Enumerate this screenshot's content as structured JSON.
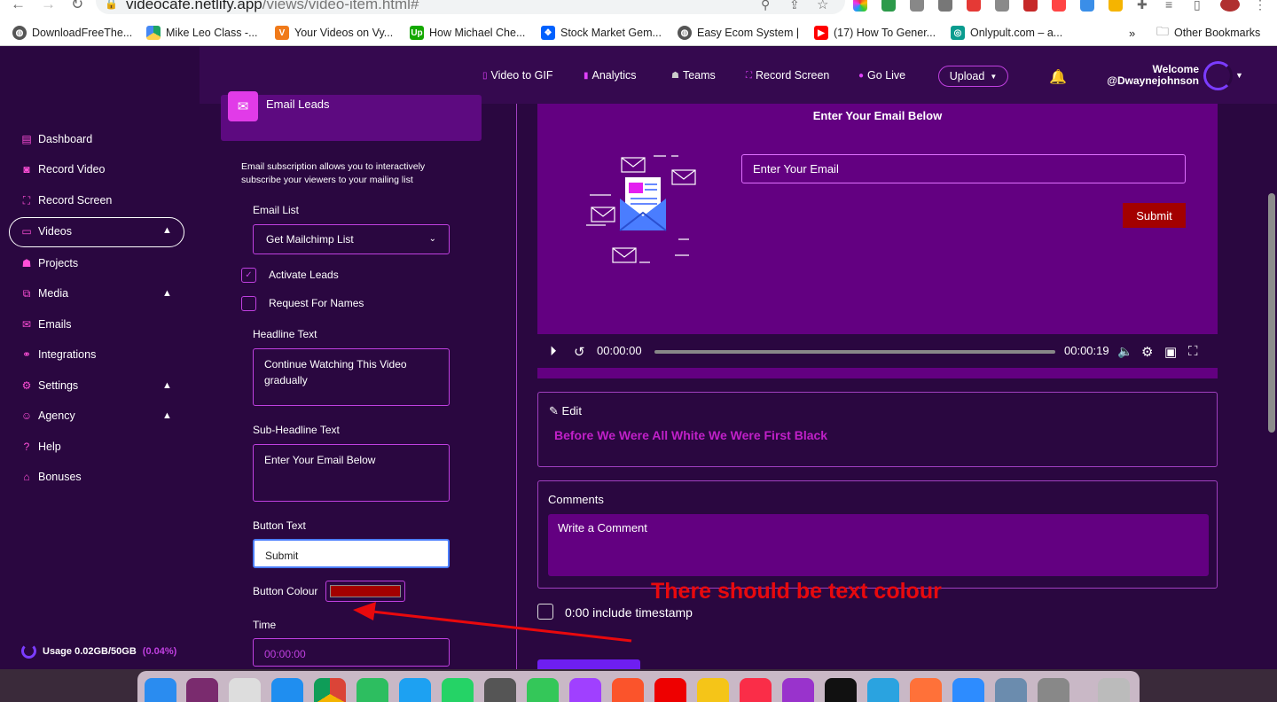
{
  "browser": {
    "url_host": "videocafe.netlify.app",
    "url_path": "/views/video-item.html#",
    "bookmarks": [
      {
        "label": "DownloadFreeThe...",
        "icon": "globe-icon"
      },
      {
        "label": "Mike Leo Class -...",
        "icon": "google-drive-icon"
      },
      {
        "label": "Your Videos on Vy...",
        "icon": "vyond-icon"
      },
      {
        "label": "How Michael Che...",
        "icon": "upwork-icon"
      },
      {
        "label": "Stock Market Gem...",
        "icon": "dropbox-icon"
      },
      {
        "label": "Easy Ecom System |",
        "icon": "globe-icon"
      },
      {
        "label": "(17) How To Gener...",
        "icon": "youtube-icon"
      },
      {
        "label": "Onlypult.com – a...",
        "icon": "onlypult-icon"
      }
    ],
    "overflow": "»",
    "other_bookmarks": "Other Bookmarks"
  },
  "topnav": {
    "video_to_gif": "Video to GIF",
    "analytics": "Analytics",
    "teams": "Teams",
    "record_screen": "Record Screen",
    "go_live": "Go Live",
    "upload": "Upload",
    "welcome": "Welcome",
    "username": "@Dwaynejohnson"
  },
  "sidebar": {
    "items": [
      {
        "label": "Dashboard",
        "icon": "dashboard-icon"
      },
      {
        "label": "Record Video",
        "icon": "camera-icon"
      },
      {
        "label": "Record Screen",
        "icon": "screen-icon"
      },
      {
        "label": "Videos",
        "icon": "video-icon",
        "expanded": true
      },
      {
        "label": "Projects",
        "icon": "projects-icon"
      },
      {
        "label": "Media",
        "icon": "media-icon"
      },
      {
        "label": "Emails",
        "icon": "mail-icon"
      },
      {
        "label": "Integrations",
        "icon": "integrations-icon"
      },
      {
        "label": "Settings",
        "icon": "gear-icon"
      },
      {
        "label": "Agency",
        "icon": "agency-icon"
      },
      {
        "label": "Help",
        "icon": "help-icon"
      },
      {
        "label": "Bonuses",
        "icon": "gift-icon"
      }
    ],
    "usage_label": "Usage 0.02GB/50GB",
    "usage_pct": "(0.04%)"
  },
  "panel": {
    "title": "Email Leads",
    "description": "Email subscription allows you to interactively subscribe your viewers to your mailing list",
    "email_list_label": "Email List",
    "email_list_value": "Get Mailchimp List",
    "activate_leads": "Activate Leads",
    "activate_leads_checked": true,
    "request_names": "Request For Names",
    "request_names_checked": false,
    "headline_label": "Headline Text",
    "headline_value": "Continue Watching This Video gradually",
    "subheadline_label": "Sub-Headline Text",
    "subheadline_value": "Enter Your Email Below",
    "button_text_label": "Button Text",
    "button_text_value": "Submit",
    "button_colour_label": "Button Colour",
    "button_colour_value": "#a30000",
    "time_label": "Time",
    "time_value": "00:00:00"
  },
  "video": {
    "heading": "Enter Your Email Below",
    "email_placeholder": "Enter Your Email",
    "submit": "Submit",
    "current_time": "00:00:00",
    "duration": "00:00:19",
    "progress_fraction": 0
  },
  "edit": {
    "label": "Edit",
    "video_title": "Before We Were All White We Were First Black"
  },
  "comments": {
    "label": "Comments",
    "placeholder": "Write a Comment",
    "timestamp_label": "0:00 include timestamp"
  },
  "annotation": {
    "text": "There should be text colour",
    "color": "#e8090d"
  },
  "colors": {
    "bg": "#2a0740",
    "accent": "#c040e0",
    "video_bg": "#630081",
    "submit": "#a30000"
  }
}
